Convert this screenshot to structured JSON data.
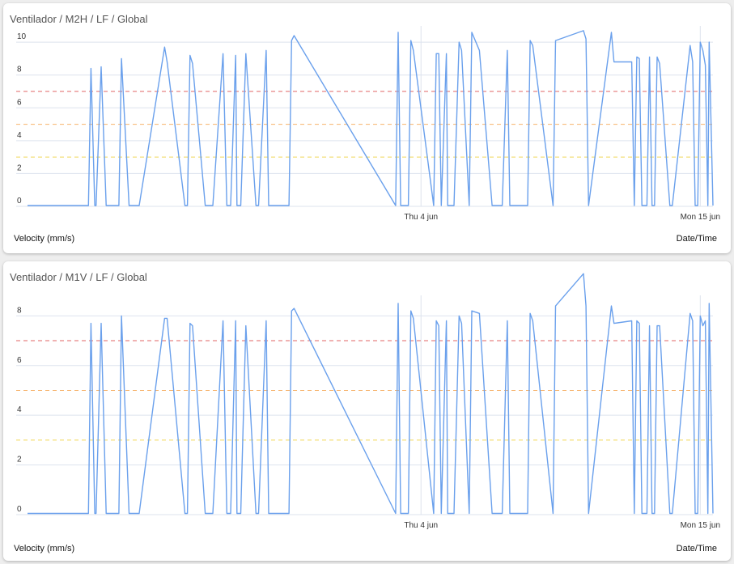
{
  "cards": [
    {
      "title": "Ventilador / M2H / LF / Global",
      "y_axis_label": "Velocity (mm/s)",
      "x_axis_label": "Date/Time"
    },
    {
      "title": "Ventilador / M1V / LF / Global",
      "y_axis_label": "Velocity (mm/s)",
      "x_axis_label": "Date/Time"
    }
  ],
  "chart_data": [
    {
      "type": "line",
      "title": "Ventilador / M2H / LF / Global",
      "ylabel": "Velocity (mm/s)",
      "xlabel": "Date/Time",
      "ylim": [
        0,
        10.5
      ],
      "yticks": [
        0,
        2,
        4,
        6,
        8,
        10
      ],
      "xlim": [
        -11.5,
        15.5
      ],
      "xticks": [
        {
          "label": "Thu 4 jun",
          "x": 4
        },
        {
          "label": "Mon 15 jun",
          "x": 15
        }
      ],
      "grid": true,
      "series_color": "#6aa0ec",
      "thresholds": [
        {
          "value": 7,
          "color": "#e06666"
        },
        {
          "value": 5,
          "color": "#f6b26b"
        },
        {
          "value": 3,
          "color": "#f1d65a"
        }
      ],
      "x": [
        -11.5,
        -9.1,
        -9,
        -8.85,
        -8.8,
        -8.6,
        -8.4,
        -7.9,
        -7.8,
        -7.5,
        -7.2,
        -7.1,
        -6.1,
        -6,
        -5.3,
        -5.2,
        -5.1,
        -5,
        -4.5,
        -4.2,
        -3.8,
        -3.65,
        -3.5,
        -3.3,
        -3.25,
        -3.1,
        -2.9,
        -2.5,
        -2.4,
        -2.1,
        -2,
        -1.8,
        -1.5,
        -1.2,
        -1.1,
        -1,
        3.0,
        3.1,
        3.2,
        3.5,
        3.6,
        3.7,
        4.5,
        4.6,
        4.7,
        4.8,
        5,
        5.05,
        5.3,
        5.5,
        5.6,
        5.9,
        6.0,
        6.3,
        6.8,
        7.2,
        7.4,
        7.5,
        8.2,
        8.3,
        8.4,
        9.2,
        9.3,
        10.4,
        10.5,
        10.6,
        11.5,
        11.6,
        12.3,
        12.4,
        12.5,
        12.6,
        12.7,
        12.9,
        13.0,
        13.1,
        13.2,
        13.3,
        13.4,
        13.8,
        13.9,
        14.6,
        14.7,
        14.8,
        14.9,
        15.0,
        15.1,
        15.2,
        15.3,
        15.35,
        15.5
      ],
      "values": [
        0.05,
        0.05,
        8.4,
        0.05,
        0.05,
        8.5,
        0.05,
        0.05,
        9,
        0.05,
        0.05,
        0.05,
        9.7,
        8.8,
        0.05,
        0.05,
        9.2,
        8.7,
        0.05,
        0.05,
        9.3,
        0.05,
        0.05,
        9.2,
        0.05,
        0.05,
        9.3,
        0.05,
        0.05,
        9.5,
        0.05,
        0.05,
        0.05,
        0.05,
        10.1,
        10.4,
        0.05,
        10.6,
        0.05,
        0.05,
        10.1,
        9.5,
        0.05,
        9.3,
        9.3,
        0.05,
        9.3,
        0.05,
        0.05,
        10,
        9.5,
        0.05,
        10.6,
        9.5,
        0.05,
        0.05,
        9.5,
        0.05,
        0.05,
        10.1,
        9.8,
        0.05,
        10.1,
        10.7,
        10.2,
        0.05,
        10.6,
        8.8,
        8.8,
        0.05,
        9.1,
        9.0,
        0.05,
        0.05,
        9.1,
        0.05,
        0.05,
        9.1,
        8.7,
        0.05,
        0.05,
        9.8,
        8.8,
        0.05,
        0.05,
        10,
        9.5,
        8.6,
        0.05,
        10,
        0.05
      ]
    },
    {
      "type": "line",
      "title": "Ventilador / M1V / LF / Global",
      "ylabel": "Velocity (mm/s)",
      "xlabel": "Date/Time",
      "ylim": [
        0,
        8.5
      ],
      "yticks": [
        0,
        2,
        4,
        6,
        8
      ],
      "xlim": [
        -11.5,
        15.5
      ],
      "xticks": [
        {
          "label": "Thu 4 jun",
          "x": 4
        },
        {
          "label": "Mon 15 jun",
          "x": 15
        }
      ],
      "grid": true,
      "series_color": "#6aa0ec",
      "thresholds": [
        {
          "value": 7,
          "color": "#e06666"
        },
        {
          "value": 5,
          "color": "#f6b26b"
        },
        {
          "value": 3,
          "color": "#f1d65a"
        }
      ],
      "x": [
        -11.5,
        -9.1,
        -9,
        -8.85,
        -8.8,
        -8.6,
        -8.4,
        -7.9,
        -7.8,
        -7.5,
        -7.2,
        -7.1,
        -6.1,
        -6,
        -5.3,
        -5.2,
        -5.1,
        -5,
        -4.5,
        -4.2,
        -3.8,
        -3.65,
        -3.5,
        -3.3,
        -3.25,
        -3.1,
        -2.9,
        -2.5,
        -2.4,
        -2.1,
        -2,
        -1.8,
        -1.5,
        -1.2,
        -1.1,
        -1,
        3.0,
        3.1,
        3.2,
        3.5,
        3.6,
        3.7,
        4.5,
        4.6,
        4.7,
        4.8,
        5,
        5.05,
        5.3,
        5.5,
        5.6,
        5.9,
        6.0,
        6.3,
        6.8,
        7.2,
        7.4,
        7.5,
        8.2,
        8.3,
        8.4,
        9.2,
        9.3,
        10.4,
        10.5,
        10.6,
        11.5,
        11.6,
        12.3,
        12.4,
        12.5,
        12.6,
        12.7,
        12.9,
        13.0,
        13.1,
        13.2,
        13.3,
        13.4,
        13.8,
        13.9,
        14.6,
        14.7,
        14.8,
        14.9,
        15.0,
        15.1,
        15.2,
        15.3,
        15.35,
        15.5
      ],
      "values": [
        0.05,
        0.05,
        7.7,
        0.05,
        0.05,
        7.7,
        0.05,
        0.05,
        8.0,
        0.05,
        0.05,
        0.05,
        7.9,
        7.9,
        0.05,
        0.05,
        7.7,
        7.6,
        0.05,
        0.05,
        7.8,
        0.05,
        0.05,
        7.8,
        0.05,
        0.05,
        7.6,
        0.05,
        0.05,
        7.8,
        0.05,
        0.05,
        0.05,
        0.05,
        8.2,
        8.3,
        0.05,
        8.5,
        0.05,
        0.05,
        8.2,
        7.9,
        0.05,
        7.8,
        7.6,
        0.05,
        7.8,
        0.05,
        0.05,
        8,
        7.7,
        0.05,
        8.2,
        8.1,
        0.05,
        0.05,
        7.8,
        0.05,
        0.05,
        8.1,
        7.8,
        0.05,
        8.4,
        9.7,
        8.4,
        0.05,
        8.4,
        7.7,
        7.8,
        0.05,
        7.8,
        7.7,
        0.05,
        0.05,
        7.6,
        0.05,
        0.05,
        7.6,
        7.6,
        0.05,
        0.05,
        8.1,
        7.8,
        0.05,
        0.05,
        8.0,
        7.6,
        7.8,
        0.05,
        8.5,
        0.05
      ]
    }
  ]
}
